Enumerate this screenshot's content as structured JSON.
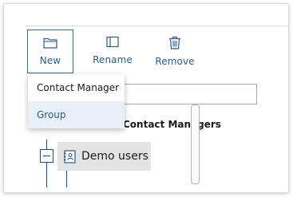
{
  "toolbar": {
    "new_label": "New",
    "rename_label": "Rename",
    "remove_label": "Remove"
  },
  "new_menu": {
    "items": [
      {
        "label": "Contact Manager"
      },
      {
        "label": "Group"
      }
    ]
  },
  "search": {
    "value": ""
  },
  "tree": {
    "heading": "Contact Managers",
    "node": {
      "label": "Demo users"
    }
  },
  "colors": {
    "accent": "#2f5d86",
    "button_border": "#2f6ea8",
    "menu_highlight": "#e9eff6",
    "node_selected_bg": "#e4e4e4"
  },
  "icons": {
    "new": "folder-icon",
    "rename": "rename-icon",
    "remove": "trash-icon",
    "node": "address-book-icon",
    "collapse": "collapse-minus-icon"
  }
}
